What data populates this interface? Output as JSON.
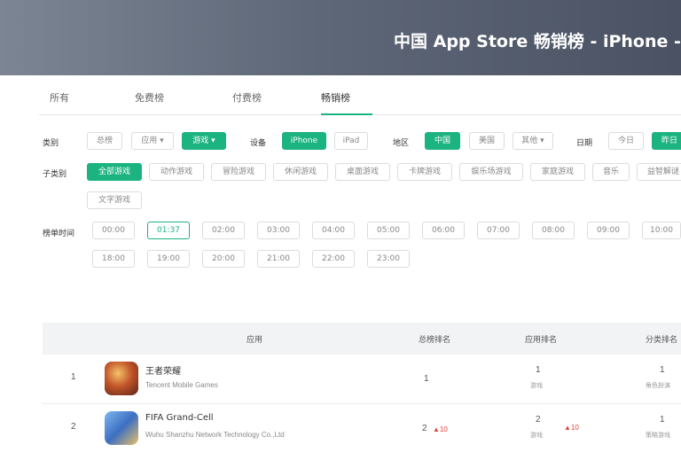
{
  "header": {
    "title": "中国 App Store 畅销榜 - iPhone -"
  },
  "tabs": [
    "所有",
    "免费榜",
    "付费榜",
    "畅销榜"
  ],
  "filters": {
    "region": {
      "label": "类别",
      "options": [
        "总榜",
        "应用 ▾",
        "游戏 ▾"
      ]
    },
    "device": {
      "label": "设备",
      "options": [
        "iPhone",
        "iPad"
      ]
    },
    "country": {
      "label": "地区",
      "options": [
        "中国",
        "美国",
        "其他 ▾"
      ]
    },
    "date": {
      "label": "日期",
      "options": [
        "今日",
        "昨日"
      ]
    },
    "subcategory": {
      "label": "子类别",
      "options": [
        "全部游戏",
        "动作游戏",
        "冒险游戏",
        "休闲游戏",
        "桌面游戏",
        "卡牌游戏",
        "娱乐场游戏",
        "家庭游戏",
        "音乐",
        "益智解谜",
        "文字游戏"
      ]
    },
    "time": {
      "label": "榜单时间",
      "times": [
        "00:00",
        "01:37",
        "02:00",
        "03:00",
        "04:00",
        "05:00",
        "06:00",
        "07:00",
        "08:00",
        "09:00",
        "10:00",
        "18:00",
        "19:00",
        "20:00",
        "21:00",
        "22:00",
        "23:00"
      ]
    }
  },
  "table": {
    "headers": [
      "应用",
      "总榜排名",
      "应用排名",
      "分类排名"
    ],
    "rows": [
      {
        "rank": "1",
        "name": "王者荣耀",
        "developer": "Tencent Mobile Games",
        "overall": "1",
        "overall_change": "",
        "app_rank": "1",
        "app_rank_sub": "游戏",
        "app_change": "",
        "cat_rank": "1",
        "cat_rank_sub": "角色扮演"
      },
      {
        "rank": "2",
        "name": "FIFA Grand-Cell",
        "developer": "Wuhu Shanzhu Network Technology Co.,Ltd",
        "overall": "2",
        "overall_change": "▲10",
        "app_rank": "2",
        "app_rank_sub": "游戏",
        "app_change": "▲10",
        "cat_rank": "1",
        "cat_rank_sub": "策略游戏"
      }
    ]
  },
  "colors": {
    "accent": "#1bb37f",
    "banner": "#5f6878",
    "up": "#e0433d"
  }
}
